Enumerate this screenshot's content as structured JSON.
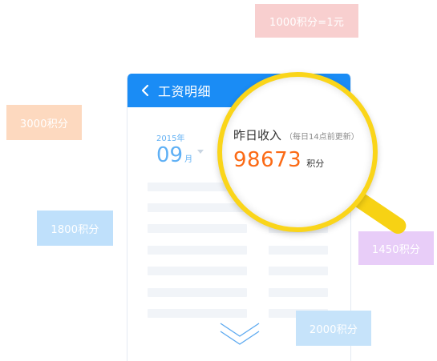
{
  "tags": [
    {
      "text": "1000积分=1元"
    },
    {
      "text": "3000积分"
    },
    {
      "text": "1800积分"
    },
    {
      "text": "1450积分"
    },
    {
      "text": "2000积分"
    }
  ],
  "card": {
    "title": "工资明细",
    "year": "2015年",
    "month": "09",
    "month_unit": "月"
  },
  "magnifier": {
    "title": "昨日收入",
    "note": "（每日14点前更新）",
    "value": "98673",
    "unit": "积分"
  },
  "colors": {
    "header_blue": "#1a8cf5",
    "value_orange": "#fb6a15",
    "magnifier_yellow": "#fad51a"
  },
  "icons": [
    "back-arrow-icon",
    "dropdown-arrow-icon",
    "double-chevron-down-icon",
    "magnifier-icon"
  ]
}
